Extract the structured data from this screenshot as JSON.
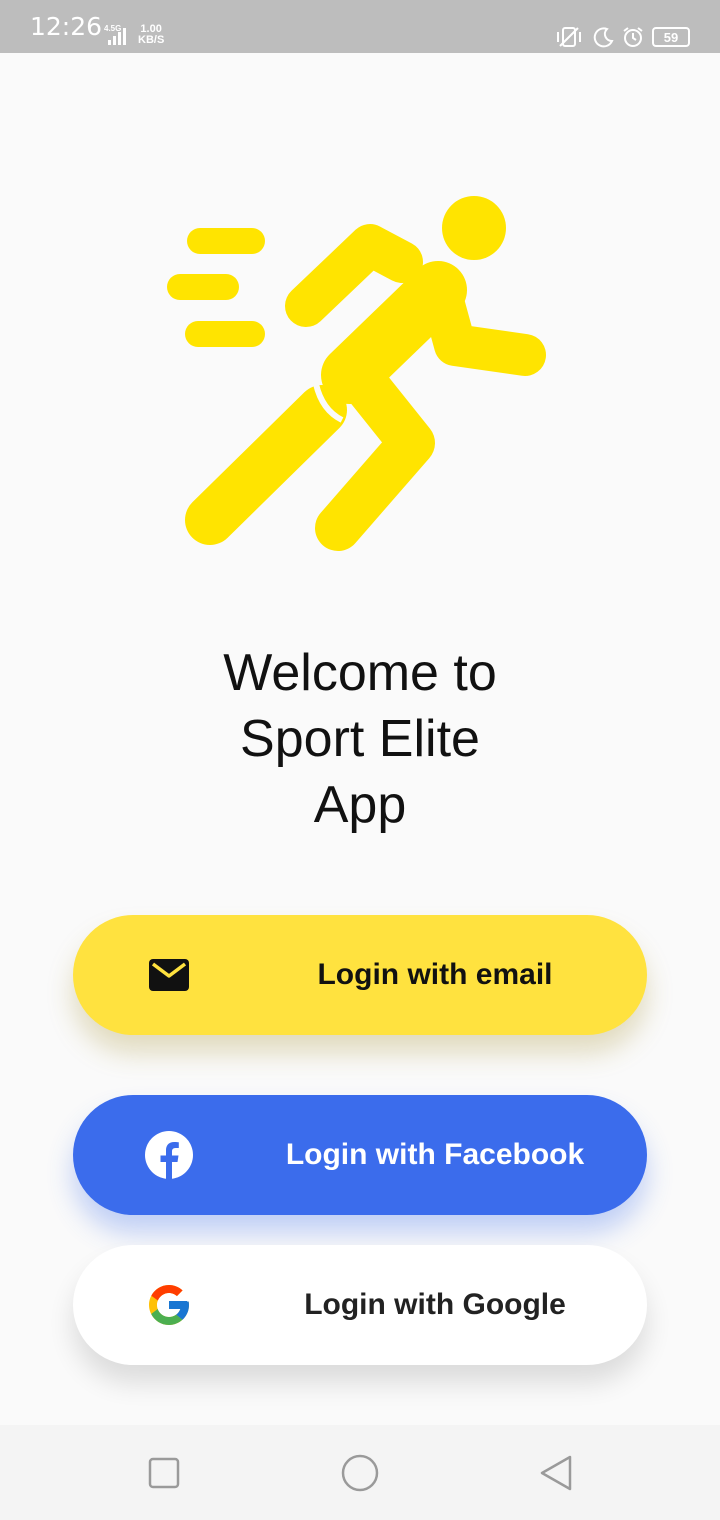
{
  "status_bar": {
    "time": "12:26",
    "network_type": "4.5G",
    "speed_value": "1.00",
    "speed_unit": "KB/S",
    "battery": "59",
    "icons": [
      "signal-icon",
      "vibrate-icon",
      "moon-icon",
      "alarm-icon",
      "battery-icon"
    ]
  },
  "logo": {
    "name": "running-man-logo",
    "color": "#FFE400"
  },
  "welcome": {
    "line1": "Welcome to",
    "line2": "Sport Elite",
    "line3": "App"
  },
  "buttons": {
    "email": {
      "label": "Login with email",
      "icon": "mail-icon",
      "color": "#FFE23F"
    },
    "facebook": {
      "label": "Login with Facebook",
      "icon": "facebook-icon",
      "color": "#3B6CEC"
    },
    "google": {
      "label": "Login with Google",
      "icon": "google-icon",
      "color": "#FFFFFF"
    }
  },
  "nav_bar": {
    "icons": [
      "recents-square-icon",
      "home-circle-icon",
      "back-triangle-icon"
    ]
  }
}
